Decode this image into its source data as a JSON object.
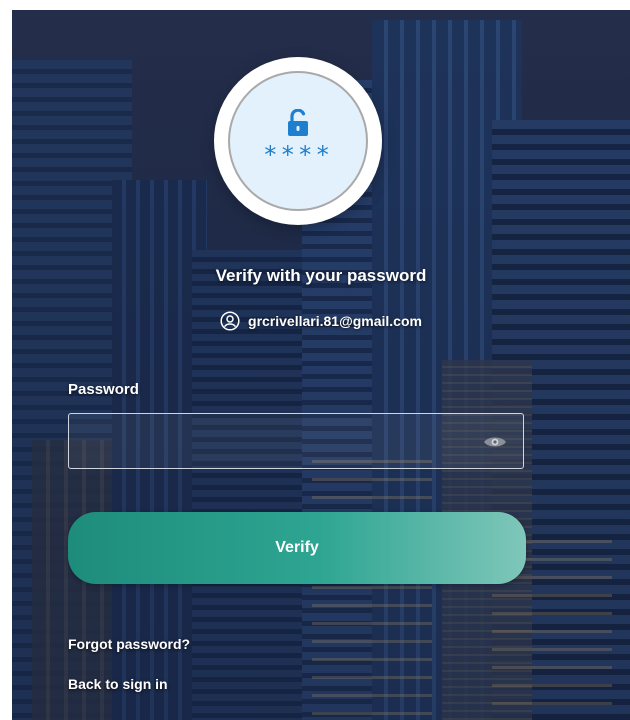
{
  "auth": {
    "title": "Verify with your password",
    "identifier": "grcrivellari.81@gmail.com",
    "password_label": "Password",
    "password_value": "",
    "verify_label": "Verify",
    "forgot_label": "Forgot password?",
    "back_label": "Back to sign in",
    "badge_text": "****"
  },
  "icons": {
    "badge": "lock-open-icon",
    "identity": "user-circle-icon",
    "reveal": "eye-icon"
  },
  "colors": {
    "accent_button_start": "#1e8c7b",
    "accent_button_end": "#7fc7ba",
    "badge_bg": "#e3f1fc",
    "badge_icon": "#1e7fce"
  }
}
